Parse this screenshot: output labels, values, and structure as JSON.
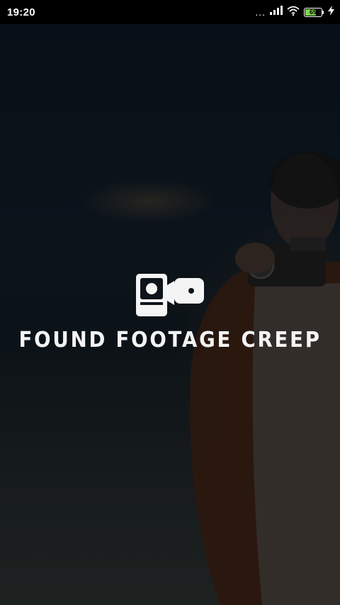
{
  "status_bar": {
    "time": "19:20",
    "signal_dots": "...",
    "battery_level": "69",
    "battery_fraction": 0.69,
    "icons": [
      "signal-icon",
      "wifi-icon",
      "battery-icon",
      "charging-icon"
    ]
  },
  "splash": {
    "app_title": "FOUND FOOTAGE CREEP",
    "logo_icon": "camcorder-icon"
  },
  "colors": {
    "status_bar_bg": "#000000",
    "battery_fill": "#7fd34b",
    "title_text": "#f4f4f4"
  }
}
